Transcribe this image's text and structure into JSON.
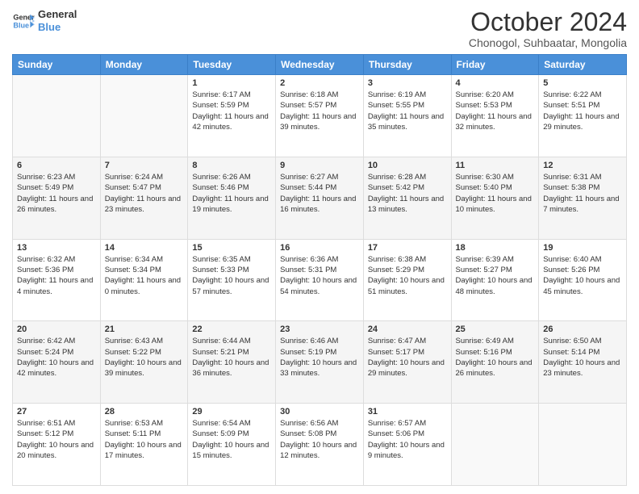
{
  "logo": {
    "line1": "General",
    "line2": "Blue"
  },
  "title": "October 2024",
  "subtitle": "Chonogol, Suhbaatar, Mongolia",
  "weekdays": [
    "Sunday",
    "Monday",
    "Tuesday",
    "Wednesday",
    "Thursday",
    "Friday",
    "Saturday"
  ],
  "weeks": [
    [
      {
        "day": "",
        "info": ""
      },
      {
        "day": "",
        "info": ""
      },
      {
        "day": "1",
        "info": "Sunrise: 6:17 AM\nSunset: 5:59 PM\nDaylight: 11 hours and 42 minutes."
      },
      {
        "day": "2",
        "info": "Sunrise: 6:18 AM\nSunset: 5:57 PM\nDaylight: 11 hours and 39 minutes."
      },
      {
        "day": "3",
        "info": "Sunrise: 6:19 AM\nSunset: 5:55 PM\nDaylight: 11 hours and 35 minutes."
      },
      {
        "day": "4",
        "info": "Sunrise: 6:20 AM\nSunset: 5:53 PM\nDaylight: 11 hours and 32 minutes."
      },
      {
        "day": "5",
        "info": "Sunrise: 6:22 AM\nSunset: 5:51 PM\nDaylight: 11 hours and 29 minutes."
      }
    ],
    [
      {
        "day": "6",
        "info": "Sunrise: 6:23 AM\nSunset: 5:49 PM\nDaylight: 11 hours and 26 minutes."
      },
      {
        "day": "7",
        "info": "Sunrise: 6:24 AM\nSunset: 5:47 PM\nDaylight: 11 hours and 23 minutes."
      },
      {
        "day": "8",
        "info": "Sunrise: 6:26 AM\nSunset: 5:46 PM\nDaylight: 11 hours and 19 minutes."
      },
      {
        "day": "9",
        "info": "Sunrise: 6:27 AM\nSunset: 5:44 PM\nDaylight: 11 hours and 16 minutes."
      },
      {
        "day": "10",
        "info": "Sunrise: 6:28 AM\nSunset: 5:42 PM\nDaylight: 11 hours and 13 minutes."
      },
      {
        "day": "11",
        "info": "Sunrise: 6:30 AM\nSunset: 5:40 PM\nDaylight: 11 hours and 10 minutes."
      },
      {
        "day": "12",
        "info": "Sunrise: 6:31 AM\nSunset: 5:38 PM\nDaylight: 11 hours and 7 minutes."
      }
    ],
    [
      {
        "day": "13",
        "info": "Sunrise: 6:32 AM\nSunset: 5:36 PM\nDaylight: 11 hours and 4 minutes."
      },
      {
        "day": "14",
        "info": "Sunrise: 6:34 AM\nSunset: 5:34 PM\nDaylight: 11 hours and 0 minutes."
      },
      {
        "day": "15",
        "info": "Sunrise: 6:35 AM\nSunset: 5:33 PM\nDaylight: 10 hours and 57 minutes."
      },
      {
        "day": "16",
        "info": "Sunrise: 6:36 AM\nSunset: 5:31 PM\nDaylight: 10 hours and 54 minutes."
      },
      {
        "day": "17",
        "info": "Sunrise: 6:38 AM\nSunset: 5:29 PM\nDaylight: 10 hours and 51 minutes."
      },
      {
        "day": "18",
        "info": "Sunrise: 6:39 AM\nSunset: 5:27 PM\nDaylight: 10 hours and 48 minutes."
      },
      {
        "day": "19",
        "info": "Sunrise: 6:40 AM\nSunset: 5:26 PM\nDaylight: 10 hours and 45 minutes."
      }
    ],
    [
      {
        "day": "20",
        "info": "Sunrise: 6:42 AM\nSunset: 5:24 PM\nDaylight: 10 hours and 42 minutes."
      },
      {
        "day": "21",
        "info": "Sunrise: 6:43 AM\nSunset: 5:22 PM\nDaylight: 10 hours and 39 minutes."
      },
      {
        "day": "22",
        "info": "Sunrise: 6:44 AM\nSunset: 5:21 PM\nDaylight: 10 hours and 36 minutes."
      },
      {
        "day": "23",
        "info": "Sunrise: 6:46 AM\nSunset: 5:19 PM\nDaylight: 10 hours and 33 minutes."
      },
      {
        "day": "24",
        "info": "Sunrise: 6:47 AM\nSunset: 5:17 PM\nDaylight: 10 hours and 29 minutes."
      },
      {
        "day": "25",
        "info": "Sunrise: 6:49 AM\nSunset: 5:16 PM\nDaylight: 10 hours and 26 minutes."
      },
      {
        "day": "26",
        "info": "Sunrise: 6:50 AM\nSunset: 5:14 PM\nDaylight: 10 hours and 23 minutes."
      }
    ],
    [
      {
        "day": "27",
        "info": "Sunrise: 6:51 AM\nSunset: 5:12 PM\nDaylight: 10 hours and 20 minutes."
      },
      {
        "day": "28",
        "info": "Sunrise: 6:53 AM\nSunset: 5:11 PM\nDaylight: 10 hours and 17 minutes."
      },
      {
        "day": "29",
        "info": "Sunrise: 6:54 AM\nSunset: 5:09 PM\nDaylight: 10 hours and 15 minutes."
      },
      {
        "day": "30",
        "info": "Sunrise: 6:56 AM\nSunset: 5:08 PM\nDaylight: 10 hours and 12 minutes."
      },
      {
        "day": "31",
        "info": "Sunrise: 6:57 AM\nSunset: 5:06 PM\nDaylight: 10 hours and 9 minutes."
      },
      {
        "day": "",
        "info": ""
      },
      {
        "day": "",
        "info": ""
      }
    ]
  ],
  "colors": {
    "header_bg": "#4a90d9",
    "accent": "#4a90d9"
  }
}
